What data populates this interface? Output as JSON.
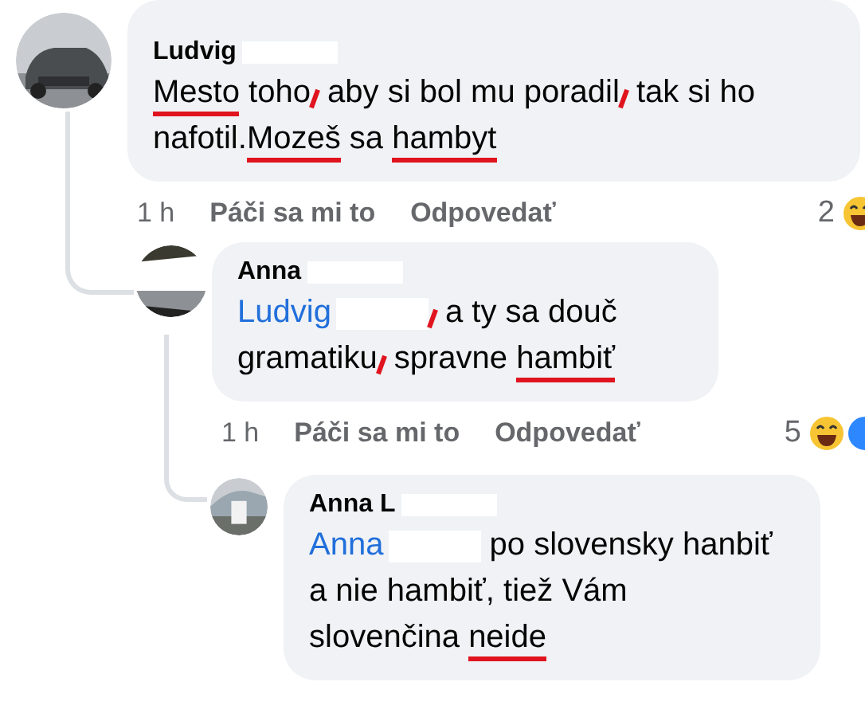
{
  "comments": [
    {
      "author": "Ludvig",
      "author_redacted": true,
      "body": [
        {
          "text": "Mesto",
          "underline": true
        },
        {
          "text": " toho",
          "underline": false
        },
        {
          "kind": "tick"
        },
        {
          "text": " aby si bol mu poradil",
          "underline": false
        },
        {
          "kind": "tick"
        },
        {
          "text": " tak si ho nafotil.",
          "underline": false
        },
        {
          "text": "Mozeš",
          "underline": true
        },
        {
          "text": " sa ",
          "underline": false
        },
        {
          "text": "hambyt",
          "underline": true
        }
      ],
      "time": "1 h",
      "like": "Páči sa mi to",
      "reply": "Odpovedať",
      "reaction_count": "2",
      "children": [
        {
          "author": "Anna",
          "author_redacted": true,
          "body": [
            {
              "kind": "mention",
              "text": "Ludvig",
              "redacted": true
            },
            {
              "kind": "tick"
            },
            {
              "text": " a ty sa douč gramatiku",
              "underline": false
            },
            {
              "kind": "tick"
            },
            {
              "text": " spravne ",
              "underline": false
            },
            {
              "text": "hambiť",
              "underline": true
            }
          ],
          "time": "1 h",
          "like": "Páči sa mi to",
          "reply": "Odpovedať",
          "reaction_count": "5",
          "children": [
            {
              "author": "Anna L",
              "author_redacted": true,
              "body": [
                {
                  "kind": "mention",
                  "text": "Anna",
                  "redacted": true
                },
                {
                  "text": " po slovensky hanbiť a nie hambiť, tiež Vám slovenčina ",
                  "underline": false
                },
                {
                  "text": "neide",
                  "underline": true
                }
              ]
            }
          ]
        }
      ]
    }
  ]
}
